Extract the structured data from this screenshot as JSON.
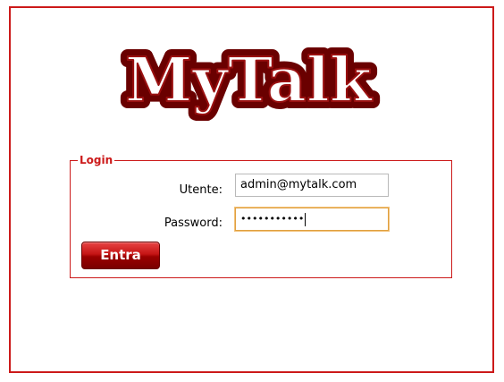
{
  "app": {
    "logo_text": "MyTalk"
  },
  "login": {
    "legend": "Login",
    "utente_label": "Utente:",
    "utente_value": "admin@mytalk.com",
    "password_label": "Password:",
    "password_masked": "•••••••••••",
    "submit_label": "Entra"
  },
  "colors": {
    "accent": "#cc1a1a",
    "logo_fill": "#ffffff",
    "logo_stroke": "#8a0a0a",
    "button_top": "#e84444",
    "button_bottom": "#7a0000",
    "focus_border": "#e0a040"
  }
}
